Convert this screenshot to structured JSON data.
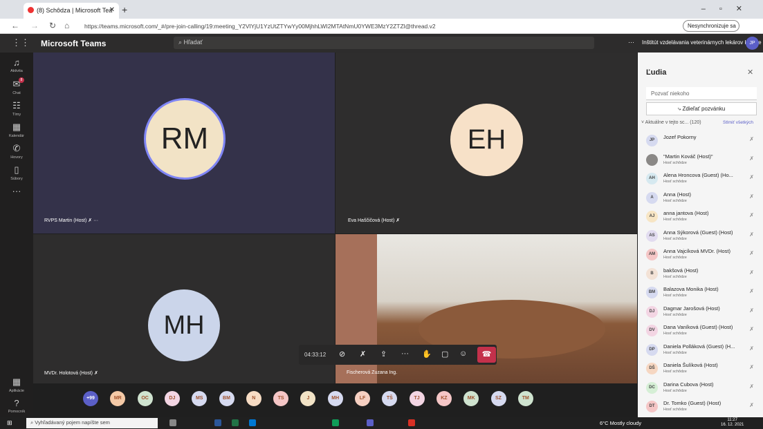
{
  "browser": {
    "tab_title": "(8) Schôdza | Microsoft Tea",
    "url": "https://teams.microsoft.com/_#/pre-join-calling/19:meeting_Y2VlYjU1YzUtZTYwYy00MjhhLWI2MTAtNmU0YWE3MzY2ZTZl@thread.v2",
    "sync_label": "Nesynchronizuje sa"
  },
  "teams": {
    "brand": "Microsoft Teams",
    "search_placeholder": "Hľadať",
    "org": "Inštitút vzdelávania veterinárnych lekárov Košice",
    "me_initials": "JP"
  },
  "rail": [
    {
      "label": "Aktivita",
      "icon": "bell-icon"
    },
    {
      "label": "Chat",
      "icon": "chat-icon",
      "badge": "8"
    },
    {
      "label": "Tímy",
      "icon": "teams-icon"
    },
    {
      "label": "Kalendár",
      "icon": "calendar-icon"
    },
    {
      "label": "Hovory",
      "icon": "phone-icon"
    },
    {
      "label": "Súbory",
      "icon": "file-icon"
    },
    {
      "label": "...",
      "icon": "more-icon"
    }
  ],
  "rail_bottom": [
    {
      "label": "Aplikácie",
      "icon": "apps-icon"
    },
    {
      "label": "Pomocník",
      "icon": "help-icon"
    }
  ],
  "tiles": [
    {
      "initials": "RM",
      "name": "RVPS Martin (Host)"
    },
    {
      "initials": "EH",
      "name": "Eva Haščičová (Host)"
    },
    {
      "initials": "MH",
      "name": "MVDr. Holotová (Host)"
    },
    {
      "initials": "",
      "name": "Fischerová Zuzana Ing."
    }
  ],
  "controls": {
    "timer": "04:33:12"
  },
  "bottom_avatars": [
    "+99",
    "MR",
    "OC",
    "DJ",
    "MS",
    "BM",
    "N",
    "TS",
    "J",
    "MH",
    "LF",
    "TŠ",
    "TJ",
    "KZ",
    "MK",
    "SZ",
    "TM"
  ],
  "people": {
    "title": "Ľudia",
    "invite_placeholder": "Pozvať niekoho",
    "share_label": "Zdieľať pozvánku",
    "current_label": "Aktuálne v tejto sc...",
    "current_count": "(120)",
    "mute_all": "Stlmiť všetkých",
    "list": [
      {
        "initials": "JP",
        "name": "Jozef Pokorny",
        "sub": ""
      },
      {
        "initials": "",
        "name": "\"Martin Kováč (Host)\"",
        "sub": "Hosť schôdze"
      },
      {
        "initials": "AH",
        "name": "Alena Hroncova (Guest) (Ho...",
        "sub": "Hosť schôdze"
      },
      {
        "initials": "A",
        "name": "Anna (Host)",
        "sub": "Hosť schôdze"
      },
      {
        "initials": "AJ",
        "name": "anna jantova (Host)",
        "sub": "Hosť schôdze"
      },
      {
        "initials": "AS",
        "name": "Anna Sýkorová (Guest) (Host)",
        "sub": "Hosť schôdze"
      },
      {
        "initials": "AM",
        "name": "Anna Vajcíková MVDr. (Host)",
        "sub": "Hosť schôdze"
      },
      {
        "initials": "B",
        "name": "bakšová (Host)",
        "sub": "Hosť schôdze"
      },
      {
        "initials": "BM",
        "name": "Balazova Monika (Host)",
        "sub": "Hosť schôdze"
      },
      {
        "initials": "DJ",
        "name": "Dagmar Jarošová (Host)",
        "sub": "Hosť schôdze"
      },
      {
        "initials": "DV",
        "name": "Dana Vaníková (Guest) (Host)",
        "sub": "Hosť schôdze"
      },
      {
        "initials": "DP",
        "name": "Daniela Polláková (Guest) (H...",
        "sub": "Hosť schôdze"
      },
      {
        "initials": "DŠ",
        "name": "Daniela Šulíková (Host)",
        "sub": "Hosť schôdze"
      },
      {
        "initials": "DC",
        "name": "Darina Cubova (Host)",
        "sub": "Hosť schôdze"
      },
      {
        "initials": "DT",
        "name": "Dr. Tomko (Guest) (Host)",
        "sub": "Hosť schôdze"
      }
    ]
  },
  "taskbar": {
    "search_placeholder": "Vyhľadávaný pojem napíšte sem",
    "weather": "6°C  Mostly cloudy",
    "time": "11:27",
    "date": "16. 12. 2021"
  }
}
